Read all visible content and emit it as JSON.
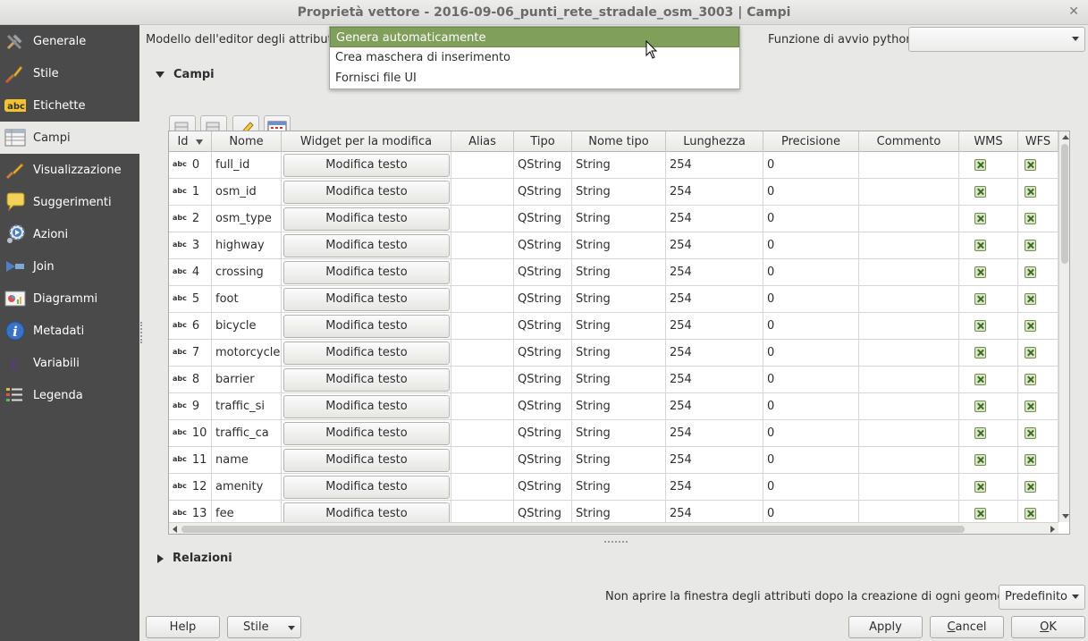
{
  "window": {
    "title": "Proprietà vettore - 2016-09-06_punti_rete_stradale_osm_3003 | Campi",
    "close_symbol": "✕"
  },
  "sidebar": {
    "items": [
      {
        "label": "Generale",
        "icon": "tools-icon"
      },
      {
        "label": "Stile",
        "icon": "paintbrush-icon"
      },
      {
        "label": "Etichette",
        "icon": "abc-label-icon"
      },
      {
        "label": "Campi",
        "icon": "table-fields-icon"
      },
      {
        "label": "Visualizzazione",
        "icon": "brush-display-icon"
      },
      {
        "label": "Suggerimenti",
        "icon": "speech-bubble-icon"
      },
      {
        "label": "Azioni",
        "icon": "gear-play-icon"
      },
      {
        "label": "Join",
        "icon": "join-icon"
      },
      {
        "label": "Diagrammi",
        "icon": "diagram-icon"
      },
      {
        "label": "Metadati",
        "icon": "info-icon"
      },
      {
        "label": "Variabili",
        "icon": "epsilon-icon"
      },
      {
        "label": "Legenda",
        "icon": "legend-icon"
      }
    ],
    "active_index": 3
  },
  "editor": {
    "layout_label": "Modello dell'editor degli attributi:",
    "layout_options": [
      "Genera automaticamente",
      "Crea maschera di inserimento",
      "Fornisci file UI"
    ],
    "layout_selected": "Genera automaticamente",
    "python_label": "Funzione di avvio python",
    "python_value": ""
  },
  "fields_section": {
    "title": "Campi",
    "toolbar": [
      "new-field-icon",
      "delete-field-icon",
      "edit-pencil-icon",
      "field-calculator-icon"
    ]
  },
  "table": {
    "columns": [
      "Id",
      "Nome",
      "Widget per la modifica",
      "Alias",
      "Tipo",
      "Nome tipo",
      "Lunghezza",
      "Precisione",
      "Commento",
      "WMS",
      "WFS"
    ],
    "type_badge": "abc",
    "rows": [
      {
        "id": "0",
        "name": "full_id",
        "widget": "Modifica testo",
        "alias": "",
        "type": "QString",
        "type_name": "String",
        "length": "254",
        "precision": "0",
        "comment": "",
        "wms": true,
        "wfs": true
      },
      {
        "id": "1",
        "name": "osm_id",
        "widget": "Modifica testo",
        "alias": "",
        "type": "QString",
        "type_name": "String",
        "length": "254",
        "precision": "0",
        "comment": "",
        "wms": true,
        "wfs": true
      },
      {
        "id": "2",
        "name": "osm_type",
        "widget": "Modifica testo",
        "alias": "",
        "type": "QString",
        "type_name": "String",
        "length": "254",
        "precision": "0",
        "comment": "",
        "wms": true,
        "wfs": true
      },
      {
        "id": "3",
        "name": "highway",
        "widget": "Modifica testo",
        "alias": "",
        "type": "QString",
        "type_name": "String",
        "length": "254",
        "precision": "0",
        "comment": "",
        "wms": true,
        "wfs": true
      },
      {
        "id": "4",
        "name": "crossing",
        "widget": "Modifica testo",
        "alias": "",
        "type": "QString",
        "type_name": "String",
        "length": "254",
        "precision": "0",
        "comment": "",
        "wms": true,
        "wfs": true
      },
      {
        "id": "5",
        "name": "foot",
        "widget": "Modifica testo",
        "alias": "",
        "type": "QString",
        "type_name": "String",
        "length": "254",
        "precision": "0",
        "comment": "",
        "wms": true,
        "wfs": true
      },
      {
        "id": "6",
        "name": "bicycle",
        "widget": "Modifica testo",
        "alias": "",
        "type": "QString",
        "type_name": "String",
        "length": "254",
        "precision": "0",
        "comment": "",
        "wms": true,
        "wfs": true
      },
      {
        "id": "7",
        "name": "motorcycle",
        "widget": "Modifica testo",
        "alias": "",
        "type": "QString",
        "type_name": "String",
        "length": "254",
        "precision": "0",
        "comment": "",
        "wms": true,
        "wfs": true
      },
      {
        "id": "8",
        "name": "barrier",
        "widget": "Modifica testo",
        "alias": "",
        "type": "QString",
        "type_name": "String",
        "length": "254",
        "precision": "0",
        "comment": "",
        "wms": true,
        "wfs": true
      },
      {
        "id": "9",
        "name": "traffic_si",
        "widget": "Modifica testo",
        "alias": "",
        "type": "QString",
        "type_name": "String",
        "length": "254",
        "precision": "0",
        "comment": "",
        "wms": true,
        "wfs": true
      },
      {
        "id": "10",
        "name": "traffic_ca",
        "widget": "Modifica testo",
        "alias": "",
        "type": "QString",
        "type_name": "String",
        "length": "254",
        "precision": "0",
        "comment": "",
        "wms": true,
        "wfs": true
      },
      {
        "id": "11",
        "name": "name",
        "widget": "Modifica testo",
        "alias": "",
        "type": "QString",
        "type_name": "String",
        "length": "254",
        "precision": "0",
        "comment": "",
        "wms": true,
        "wfs": true
      },
      {
        "id": "12",
        "name": "amenity",
        "widget": "Modifica testo",
        "alias": "",
        "type": "QString",
        "type_name": "String",
        "length": "254",
        "precision": "0",
        "comment": "",
        "wms": true,
        "wfs": true
      },
      {
        "id": "13",
        "name": "fee",
        "widget": "Modifica testo",
        "alias": "",
        "type": "QString",
        "type_name": "String",
        "length": "254",
        "precision": "0",
        "comment": "",
        "wms": true,
        "wfs": true
      }
    ]
  },
  "relations_section": {
    "title": "Relazioni"
  },
  "suppress": {
    "label": "Non aprire la finestra degli attributi dopo la creazione di ogni geometria",
    "value": "Predefinito"
  },
  "footer": {
    "help": "Help",
    "style": "Stile",
    "apply": "Apply",
    "cancel_mnemonic": "C",
    "cancel_rest": "ancel",
    "ok_mnemonic": "O",
    "ok_rest": "K"
  },
  "colors": {
    "sidebar_bg": "#4a4a4a",
    "selection_green": "#7f9f5a",
    "checkbox_green": "#3f6a24"
  }
}
